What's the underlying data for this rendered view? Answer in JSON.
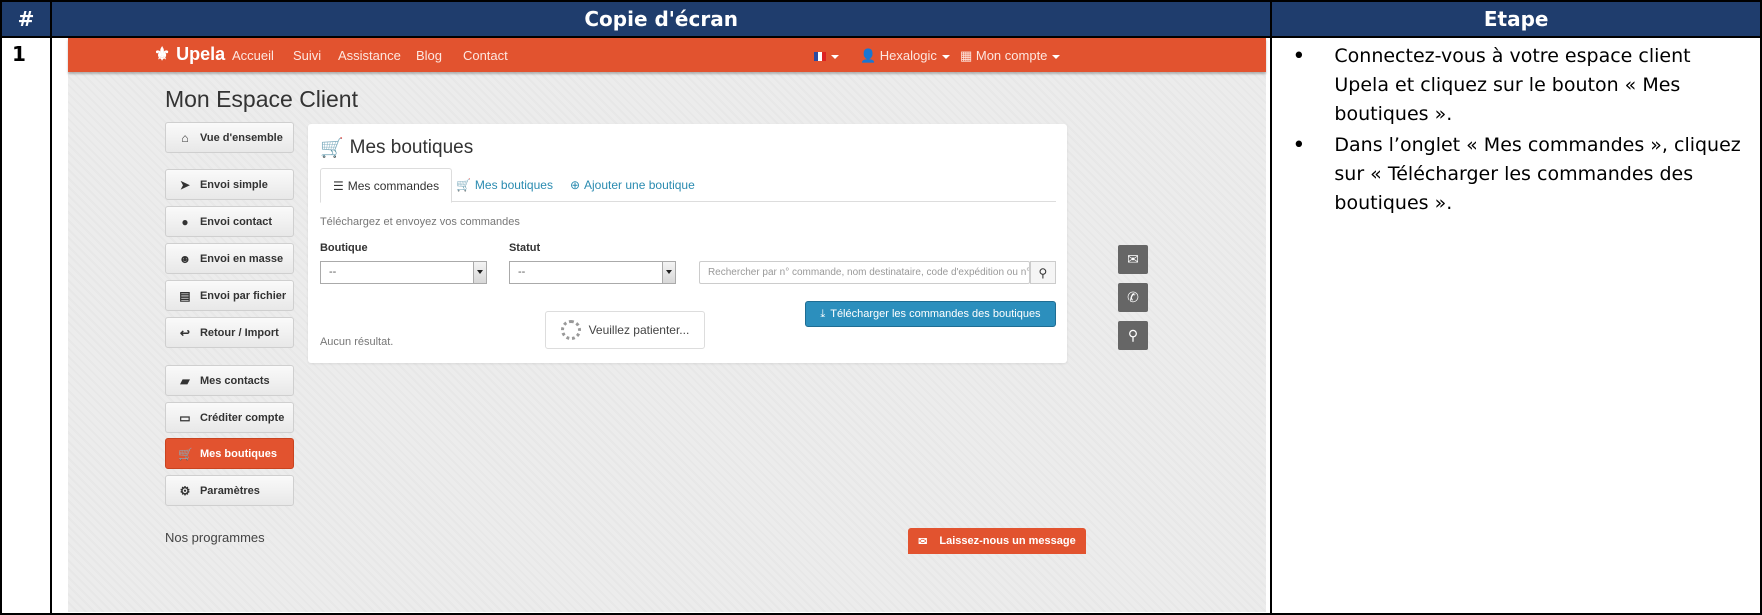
{
  "header": {
    "num": "#",
    "screenshot": "Copie d'écran",
    "step": "Etape"
  },
  "row": {
    "number": "1",
    "steps": [
      "Connectez-vous à votre espace client Upela et cliquez sur le bouton « Mes boutiques ».",
      "Dans l’onglet « Mes commandes », cliquez sur « Télécharger les commandes des boutiques »."
    ]
  },
  "screenshot": {
    "nav": {
      "brand": "Upela",
      "links": [
        "Accueil",
        "Suivi",
        "Assistance",
        "Blog",
        "Contact"
      ],
      "user": "Hexalogic",
      "account": "Mon compte"
    },
    "page_title": "Mon Espace Client",
    "sidebar": [
      {
        "label": "Vue d'ensemble",
        "icon": "home-icon",
        "glyph": "⌂"
      },
      {
        "label": "Envoi simple",
        "icon": "send-icon",
        "glyph": "➤"
      },
      {
        "label": "Envoi contact",
        "icon": "user-icon",
        "glyph": "●"
      },
      {
        "label": "Envoi en masse",
        "icon": "users-icon",
        "glyph": "☻"
      },
      {
        "label": "Envoi par fichier",
        "icon": "file-icon",
        "glyph": "▤"
      },
      {
        "label": "Retour / Import",
        "icon": "return-icon",
        "glyph": "↩"
      },
      {
        "label": "Mes contacts",
        "icon": "book-icon",
        "glyph": "▰"
      },
      {
        "label": "Créditer compte",
        "icon": "credit-card-icon",
        "glyph": "▭"
      },
      {
        "label": "Mes boutiques",
        "icon": "cart-icon",
        "glyph": "🛒"
      },
      {
        "label": "Paramètres",
        "icon": "gears-icon",
        "glyph": "⚙"
      }
    ],
    "programmes": "Nos programmes",
    "panel": {
      "title": "Mes boutiques",
      "tabs": [
        "Mes commandes",
        "Mes boutiques",
        "Ajouter une boutique"
      ],
      "helper": "Téléchargez et envoyez vos commandes",
      "boutique_label": "Boutique",
      "statut_label": "Statut",
      "boutique_value": "--",
      "statut_value": "--",
      "search_placeholder": "Rechercher par n° commande, nom destinataire, code d'expédition ou n°",
      "download_button": "Télécharger les commandes des boutiques",
      "wait_text": "Veuillez patienter...",
      "no_result": "Aucun résultat."
    },
    "message_button": "Laissez-nous un message"
  }
}
